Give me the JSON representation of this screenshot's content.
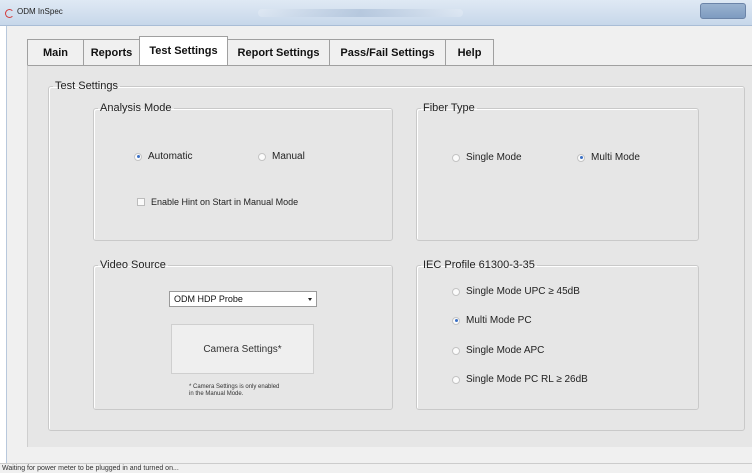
{
  "window": {
    "title": "ODM InSpec"
  },
  "tabs": [
    {
      "label": "Main"
    },
    {
      "label": "Reports"
    },
    {
      "label": "Test Settings"
    },
    {
      "label": "Report Settings"
    },
    {
      "label": "Pass/Fail Settings"
    },
    {
      "label": "Help"
    }
  ],
  "active_tab": "Test Settings",
  "test_settings": {
    "title": "Test Settings",
    "analysis_mode": {
      "title": "Analysis Mode",
      "options": [
        {
          "label": "Automatic",
          "selected": true
        },
        {
          "label": "Manual",
          "selected": false
        }
      ],
      "hint_checkbox": {
        "label": "Enable Hint on Start in Manual Mode",
        "checked": false
      }
    },
    "fiber_type": {
      "title": "Fiber Type",
      "options": [
        {
          "label": "Single Mode",
          "selected": false
        },
        {
          "label": "Multi Mode",
          "selected": true
        }
      ]
    },
    "video_source": {
      "title": "Video Source",
      "selected": "ODM HDP Probe",
      "camera_button": "Camera Settings*",
      "note_line1": "* Camera Settings is only enabled",
      "note_line2": "in the Manual Mode."
    },
    "iec_profile": {
      "title": "IEC Profile 61300-3-35",
      "options": [
        {
          "label": "Single Mode UPC ≥ 45dB",
          "selected": false
        },
        {
          "label": "Multi Mode PC",
          "selected": true
        },
        {
          "label": "Single Mode APC",
          "selected": false
        },
        {
          "label": "Single Mode  PC RL ≥ 26dB",
          "selected": false
        }
      ]
    }
  },
  "status_bar": {
    "text": "Waiting for power meter to be plugged in and turned on..."
  },
  "colors": {
    "panel_bg": "#e6e6e6",
    "window_bg": "#f0f0f0",
    "titlebar": "#d3e0ef",
    "radio_selected": "#3a6fc4"
  }
}
